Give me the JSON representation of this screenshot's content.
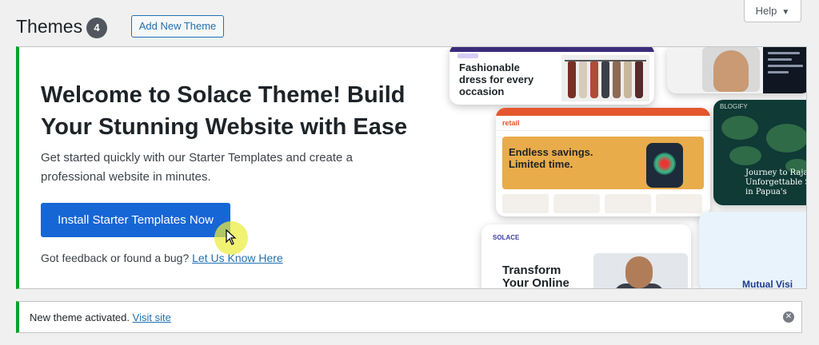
{
  "header": {
    "title": "Themes",
    "count": "4",
    "add_new_label": "Add New Theme",
    "help_label": "Help"
  },
  "welcome": {
    "heading": "Welcome to Solace Theme! Build Your Stunning Website with Ease",
    "description": "Get started quickly with our Starter Templates and create a professional website in minutes.",
    "install_label": "Install Starter Templates Now",
    "feedback_text": "Got feedback or found a bug?",
    "feedback_link": "Let Us Know Here",
    "accent_color": "#00a32a",
    "button_color": "#1766d6"
  },
  "preview": {
    "card1_title": "Fashionable dress for every occasion",
    "card3_logo": "retail",
    "card3_headline": "Endless savings. Limited time.",
    "card4_logo": "BLOGIFY",
    "card4_headline": "Journey to Raja Unforgettable S in Papua's",
    "card5_logo": "SOLACE",
    "card5_headline": "Transform Your Online",
    "card6_headline": "Mutual Visi Partners In G"
  },
  "notice": {
    "text": "New theme activated.",
    "link": "Visit site"
  },
  "icons": {
    "help_caret": "caret-down-icon",
    "dismiss": "dismiss-icon",
    "cursor": "mouse-cursor-icon"
  }
}
